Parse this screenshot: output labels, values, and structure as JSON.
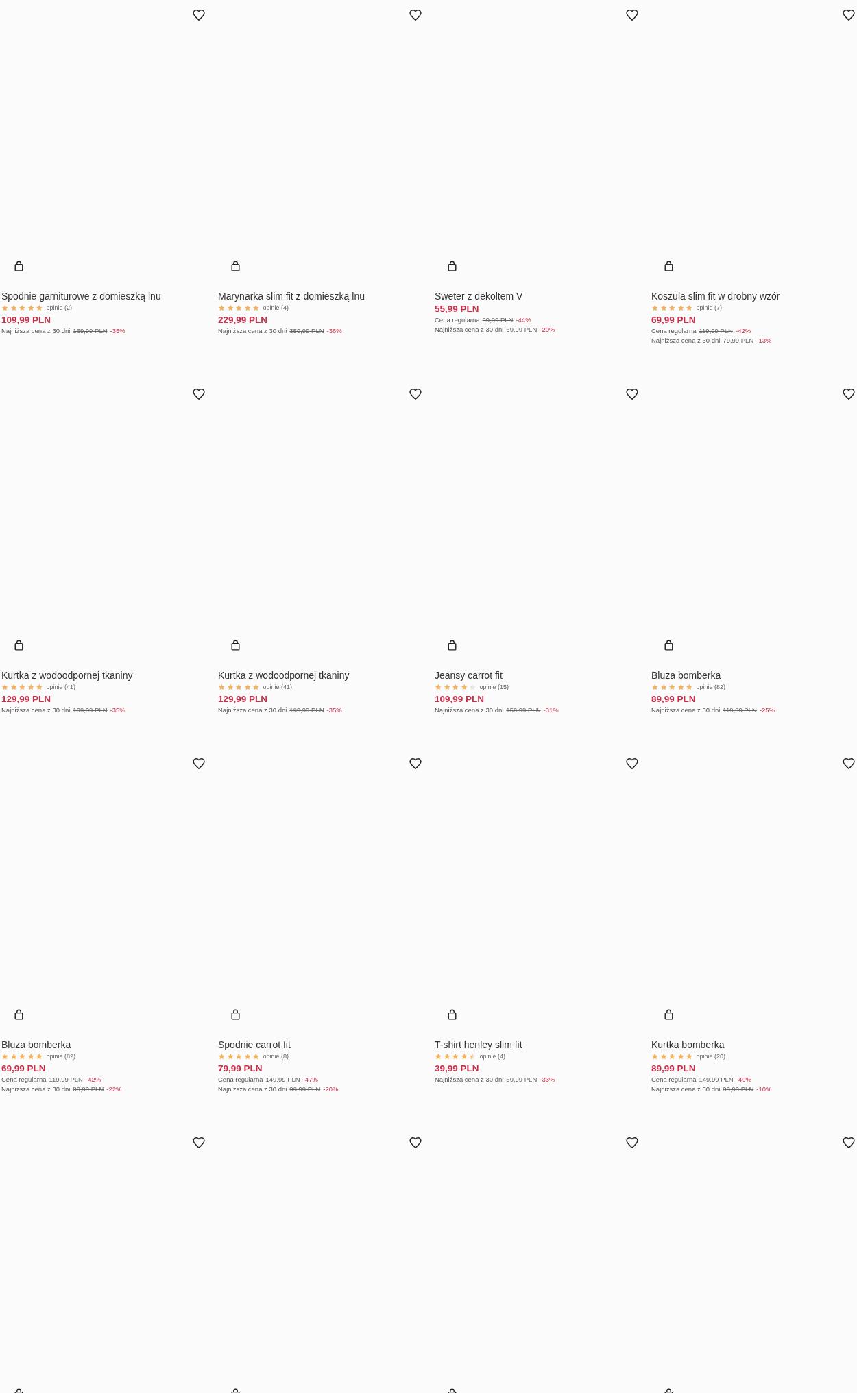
{
  "products": [
    {
      "favorite": false,
      "title": "Spodnie garniturowe z domieszką lnu",
      "stars": 5,
      "reviews": "opinie (2)",
      "price": "109,99 PLN",
      "price_notes": [
        {
          "label": "Najniższa cena z 30 dni",
          "old_price": "169,99 PLN",
          "discount": "-35%"
        }
      ]
    },
    {
      "favorite": false,
      "title": "Marynarka slim fit z domieszką lnu",
      "stars": 5,
      "reviews": "opinie (4)",
      "price": "229,99 PLN",
      "price_notes": [
        {
          "label": "Najniższa cena z 30 dni",
          "old_price": "359,99 PLN",
          "discount": "-36%"
        }
      ]
    },
    {
      "favorite": false,
      "title": "Sweter z dekoltem V",
      "price": "55,99 PLN",
      "price_notes": [
        {
          "label": "Cena regularna",
          "old_price": "99,99 PLN",
          "discount": "-44%"
        },
        {
          "label": "Najniższa cena z 30 dni",
          "old_price": "69,99 PLN",
          "discount": "-20%"
        }
      ]
    },
    {
      "favorite": false,
      "title": "Koszula slim fit w drobny wzór",
      "stars": 5,
      "reviews": "opinie (7)",
      "price": "69,99 PLN",
      "price_notes": [
        {
          "label": "Cena regularna",
          "old_price": "119,99 PLN",
          "discount": "-42%"
        },
        {
          "label": "Najniższa cena z 30 dni",
          "old_price": "79,99 PLN",
          "discount": "-13%"
        }
      ]
    },
    {
      "favorite": false,
      "title": "Kurtka z wodoodpornej tkaniny",
      "stars": 5,
      "reviews": "opinie (41)",
      "price": "129,99 PLN",
      "price_notes": [
        {
          "label": "Najniższa cena z 30 dni",
          "old_price": "199,99 PLN",
          "discount": "-35%"
        }
      ]
    },
    {
      "favorite": false,
      "title": "Kurtka z wodoodpornej tkaniny",
      "stars": 5,
      "reviews": "opinie (41)",
      "price": "129,99 PLN",
      "price_notes": [
        {
          "label": "Najniższa cena z 30 dni",
          "old_price": "199,99 PLN",
          "discount": "-35%"
        }
      ]
    },
    {
      "favorite": false,
      "title": "Jeansy carrot fit",
      "stars": 4,
      "reviews": "opinie (15)",
      "price": "109,99 PLN",
      "price_notes": [
        {
          "label": "Najniższa cena z 30 dni",
          "old_price": "159,99 PLN",
          "discount": "-31%"
        }
      ]
    },
    {
      "favorite": false,
      "title": "Bluza bomberka",
      "stars": 5,
      "reviews": "opinie (82)",
      "price": "89,99 PLN",
      "price_notes": [
        {
          "label": "Najniższa cena z 30 dni",
          "old_price": "119,99 PLN",
          "discount": "-25%"
        }
      ]
    },
    {
      "favorite": false,
      "title": "Bluza bomberka",
      "stars": 5,
      "reviews": "opinie (82)",
      "price": "69,99 PLN",
      "price_notes": [
        {
          "label": "Cena regularna",
          "old_price": "119,99 PLN",
          "discount": "-42%"
        },
        {
          "label": "Najniższa cena z 30 dni",
          "old_price": "89,99 PLN",
          "discount": "-22%"
        }
      ]
    },
    {
      "favorite": false,
      "title": "Spodnie carrot fit",
      "stars": 5,
      "reviews": "opinie (8)",
      "price": "79,99 PLN",
      "price_notes": [
        {
          "label": "Cena regularna",
          "old_price": "149,99 PLN",
          "discount": "-47%"
        },
        {
          "label": "Najniższa cena z 30 dni",
          "old_price": "99,99 PLN",
          "discount": "-20%"
        }
      ]
    },
    {
      "favorite": false,
      "title": "T-shirt henley slim fit",
      "stars": 4.5,
      "reviews": "opinie (4)",
      "price": "39,99 PLN",
      "price_notes": [
        {
          "label": "Najniższa cena z 30 dni",
          "old_price": "59,99 PLN",
          "discount": "-33%"
        }
      ]
    },
    {
      "favorite": false,
      "title": "Kurtka bomberka",
      "stars": 5,
      "reviews": "opinie (20)",
      "price": "89,99 PLN",
      "price_notes": [
        {
          "label": "Cena regularna",
          "old_price": "149,99 PLN",
          "discount": "-40%"
        },
        {
          "label": "Najniższa cena z 30 dni",
          "old_price": "99,99 PLN",
          "discount": "-10%"
        }
      ]
    },
    {
      "favorite": false
    },
    {
      "favorite": false
    },
    {
      "favorite": false
    },
    {
      "favorite": false
    }
  ]
}
